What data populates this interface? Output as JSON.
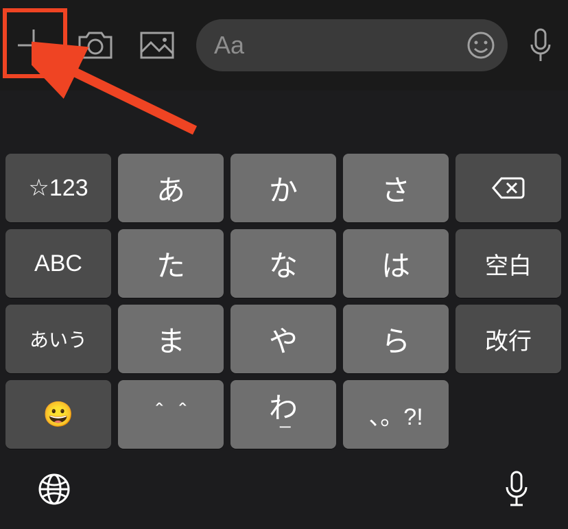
{
  "annotation": {
    "highlight_color": "#ef4423",
    "arrow_color": "#ef4423"
  },
  "toolbar": {
    "plus_icon": "plus",
    "camera_icon": "camera",
    "gallery_icon": "gallery",
    "input_placeholder": "Aa",
    "emoji_icon": "smile",
    "mic_icon": "mic"
  },
  "keyboard": {
    "rows": [
      [
        "☆123",
        "あ",
        "か",
        "さ",
        "delete"
      ],
      [
        "ABC",
        "た",
        "な",
        "は",
        "空白"
      ],
      [
        "あいう",
        "ま",
        "や",
        "ら",
        "改行"
      ],
      [
        "😀",
        "＾＾",
        "わ",
        "、。?!",
        ""
      ]
    ],
    "keys": {
      "r0c0": "☆123",
      "r0c1": "あ",
      "r0c2": "か",
      "r0c3": "さ",
      "r1c0": "ABC",
      "r1c1": "た",
      "r1c2": "な",
      "r1c3": "は",
      "r1c4": "空白",
      "r2c0": "あいう",
      "r2c1": "ま",
      "r2c2": "や",
      "r2c3": "ら",
      "r2c4_r3c4": "改行",
      "r3c0": "😀",
      "r3c1": "＾＾",
      "r3c2_top": "わ",
      "r3c2_sub": "ー",
      "r3c3": "、。?!"
    }
  },
  "bottom_bar": {
    "globe_icon": "globe",
    "mic_icon": "mic"
  }
}
